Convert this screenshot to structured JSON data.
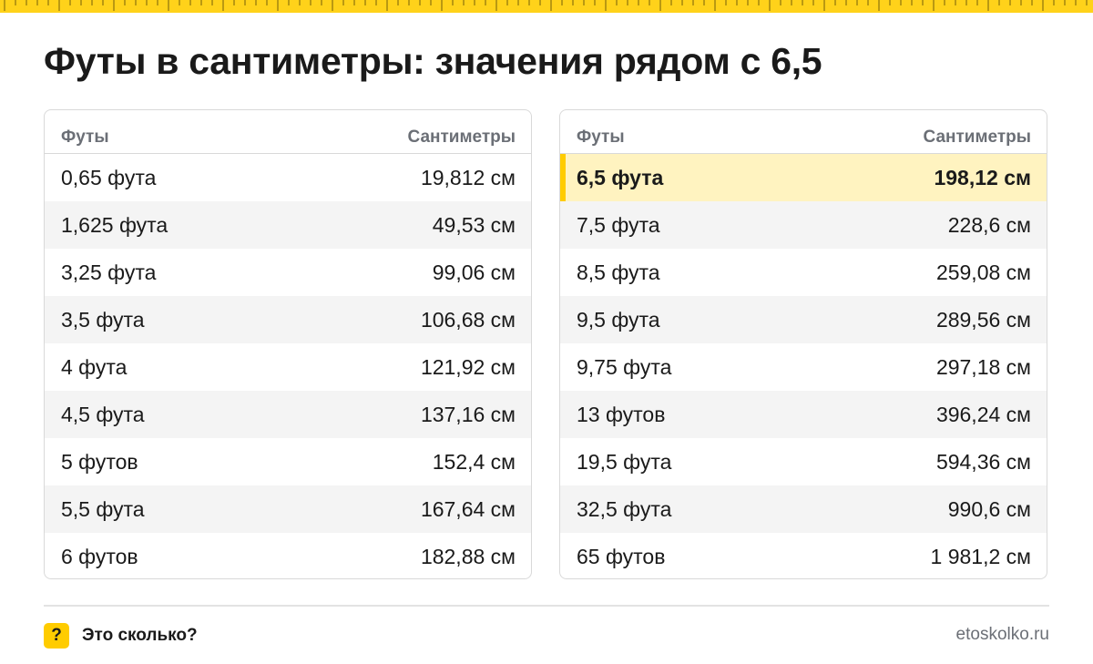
{
  "title": "Футы в сантиметры: значения рядом с 6,5",
  "colors": {
    "accent": "#ffcc00",
    "highlight_row": "#fff3c0",
    "header_text": "#6b6f76"
  },
  "tables": [
    {
      "headers": [
        "Футы",
        "Сантиметры"
      ],
      "rows": [
        {
          "feet": "0,65 фута",
          "cm": "19,812 см"
        },
        {
          "feet": "1,625 фута",
          "cm": "49,53 см"
        },
        {
          "feet": "3,25 фута",
          "cm": "99,06 см"
        },
        {
          "feet": "3,5 фута",
          "cm": "106,68 см"
        },
        {
          "feet": "4 фута",
          "cm": "121,92 см"
        },
        {
          "feet": "4,5 фута",
          "cm": "137,16 см"
        },
        {
          "feet": "5 футов",
          "cm": "152,4 см"
        },
        {
          "feet": "5,5 фута",
          "cm": "167,64 см"
        },
        {
          "feet": "6 футов",
          "cm": "182,88 см"
        }
      ]
    },
    {
      "headers": [
        "Футы",
        "Сантиметры"
      ],
      "rows": [
        {
          "feet": "6,5 фута",
          "cm": "198,12 см",
          "highlight": true
        },
        {
          "feet": "7,5 фута",
          "cm": "228,6 см"
        },
        {
          "feet": "8,5 фута",
          "cm": "259,08 см"
        },
        {
          "feet": "9,5 фута",
          "cm": "289,56 см"
        },
        {
          "feet": "9,75 фута",
          "cm": "297,18 см"
        },
        {
          "feet": "13 футов",
          "cm": "396,24 см"
        },
        {
          "feet": "19,5 фута",
          "cm": "594,36 см"
        },
        {
          "feet": "32,5 фута",
          "cm": "990,6 см"
        },
        {
          "feet": "65 футов",
          "cm": "1 981,2 см"
        }
      ]
    }
  ],
  "footer": {
    "icon": "question-mark-icon",
    "icon_glyph": "?",
    "brand": "Это сколько?",
    "site": "etoskolko.ru"
  }
}
